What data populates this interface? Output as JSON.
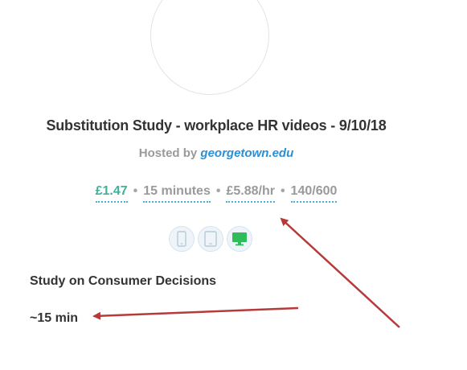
{
  "study": {
    "title": "Substitution Study - workplace HR videos - 9/10/18",
    "hosted_prefix": "Hosted by ",
    "host": "georgetown.edu",
    "reward": "£1.47",
    "time": "15 minutes",
    "rate": "£5.88/hr",
    "places": "140/600",
    "separator": "•",
    "name": "Study on Consumer Decisions",
    "duration": "~15 min"
  },
  "devices": [
    {
      "icon": "phone-icon",
      "allowed": false
    },
    {
      "icon": "tablet-icon",
      "allowed": false
    },
    {
      "icon": "desktop-icon",
      "allowed": true
    }
  ],
  "colors": {
    "reward": "#3cb39a",
    "link": "#2b8fd6",
    "muted": "#9a9a9a",
    "allowed_device": "#2dbd5a",
    "annotation_arrow": "#b73a3a"
  }
}
